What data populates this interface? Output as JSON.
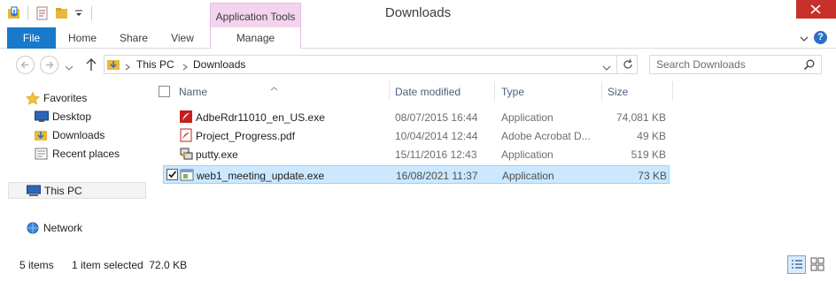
{
  "window": {
    "title": "Downloads",
    "context_tab": "Application Tools"
  },
  "ribbon": {
    "tabs": [
      "File",
      "Home",
      "Share",
      "View",
      "Manage"
    ]
  },
  "address": {
    "crumbs": [
      "This PC",
      "Downloads"
    ],
    "search_placeholder": "Search Downloads"
  },
  "navpane": {
    "items": [
      {
        "label": "Favorites",
        "icon": "star-icon"
      },
      {
        "label": "Desktop",
        "icon": "desktop-icon"
      },
      {
        "label": "Downloads",
        "icon": "downloads-folder-icon"
      },
      {
        "label": "Recent places",
        "icon": "recent-places-icon"
      },
      {
        "label": "This PC",
        "icon": "computer-icon"
      },
      {
        "label": "Network",
        "icon": "network-icon"
      }
    ]
  },
  "columns": [
    "Name",
    "Date modified",
    "Type",
    "Size"
  ],
  "files": [
    {
      "name": "AdbeRdr11010_en_US.exe",
      "date": "08/07/2015 16:44",
      "type": "Application",
      "size": "74,081 KB",
      "icon": "acrobat-installer-icon",
      "selected": false
    },
    {
      "name": "Project_Progress.pdf",
      "date": "10/04/2014 12:44",
      "type": "Adobe Acrobat D...",
      "size": "49 KB",
      "icon": "pdf-file-icon",
      "selected": false
    },
    {
      "name": "putty.exe",
      "date": "15/11/2016 12:43",
      "type": "Application",
      "size": "519 KB",
      "icon": "putty-icon",
      "selected": false
    },
    {
      "name": "web1_meeting_update.exe",
      "date": "16/08/2021 11:37",
      "type": "Application",
      "size": "73 KB",
      "icon": "exe-file-icon",
      "selected": true
    }
  ],
  "status": {
    "items_count": "5 items",
    "selection": "1 item selected  72.0 KB"
  },
  "colors": {
    "file_tab": "#1979ca",
    "context_tab": "#f3d4ec",
    "close_button": "#c7302b",
    "selection": "#cce8ff"
  }
}
